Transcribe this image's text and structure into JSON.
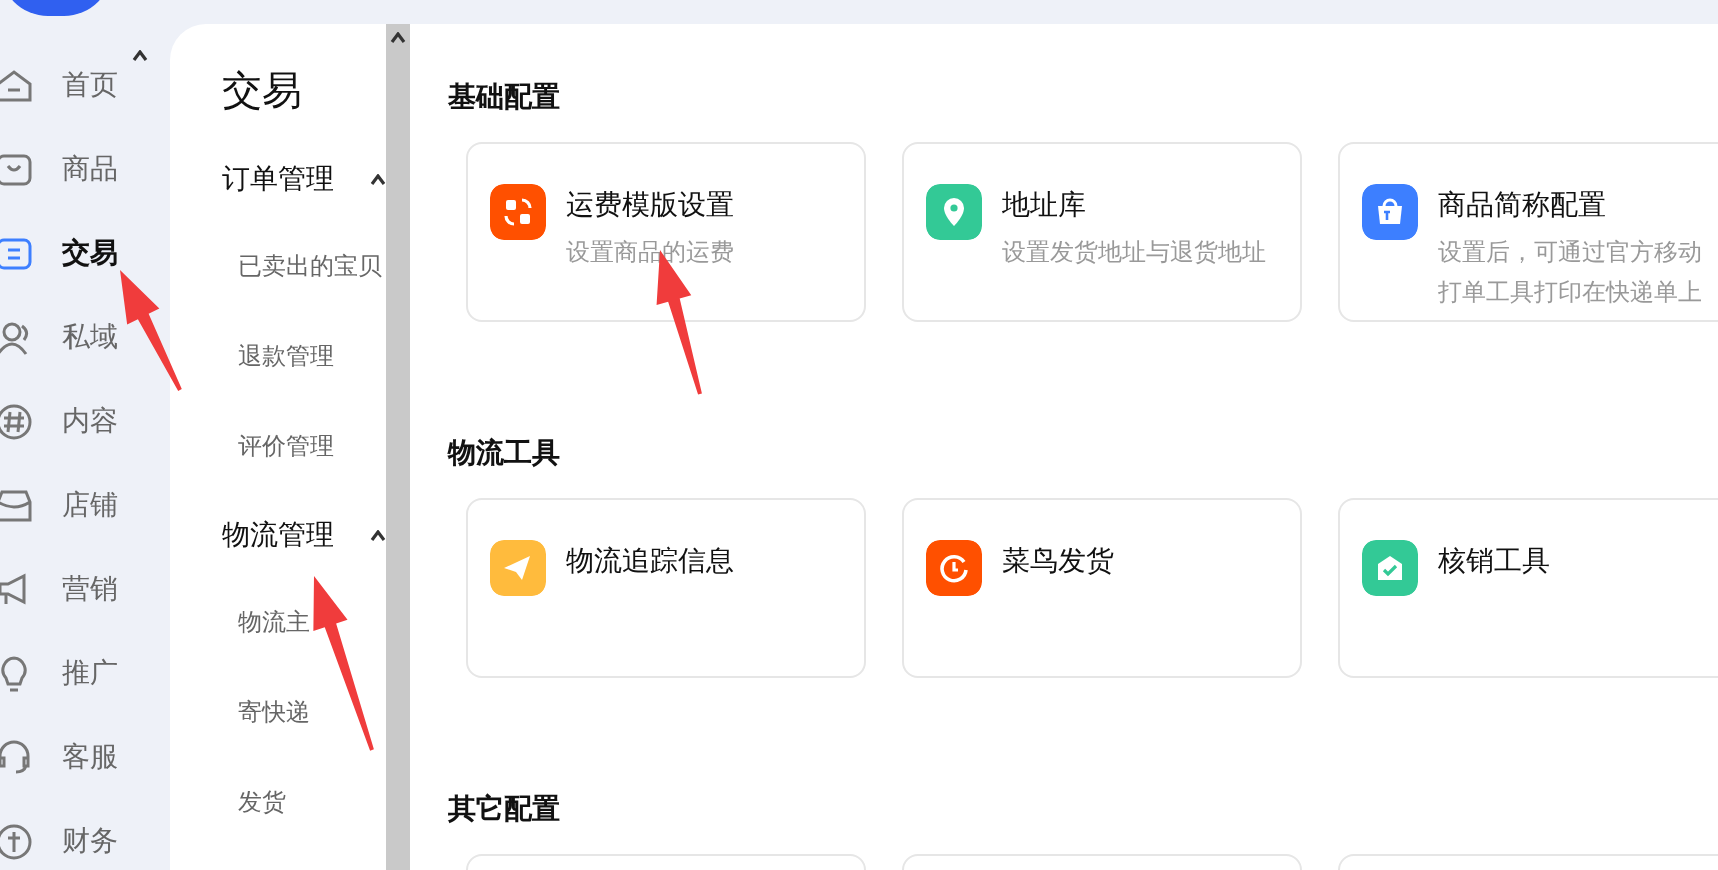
{
  "nav": {
    "items": [
      {
        "label": "首页",
        "selected": false
      },
      {
        "label": "商品",
        "selected": false
      },
      {
        "label": "交易",
        "selected": true
      },
      {
        "label": "私域",
        "selected": false
      },
      {
        "label": "内容",
        "selected": false
      },
      {
        "label": "店铺",
        "selected": false
      },
      {
        "label": "营销",
        "selected": false
      },
      {
        "label": "推广",
        "selected": false
      },
      {
        "label": "客服",
        "selected": false
      },
      {
        "label": "财务",
        "selected": false
      }
    ]
  },
  "submenu": {
    "title": "交易",
    "groups": [
      {
        "label": "订单管理",
        "expanded": true,
        "items": [
          "已卖出的宝贝",
          "退款管理",
          "评价管理"
        ]
      },
      {
        "label": "物流管理",
        "expanded": true,
        "items": [
          "物流主",
          "寄快递",
          "发货"
        ]
      }
    ]
  },
  "sections": [
    {
      "title": "基础配置",
      "cards": [
        {
          "kind": "tool",
          "title": "运费模版设置",
          "description": "设置商品的运费",
          "color": "#ff5000"
        },
        {
          "kind": "tool",
          "title": "地址库",
          "description": "设置发货地址与退货地址",
          "color": "#33c996"
        },
        {
          "kind": "tool",
          "title": "商品简称配置",
          "description": "设置后，可通过官方移动打单工具打印在快递单上",
          "color": "#3d7fff"
        }
      ]
    },
    {
      "title": "物流工具",
      "cards": [
        {
          "kind": "tool",
          "title": "物流追踪信息",
          "color": "#ffbb3d"
        },
        {
          "kind": "tool",
          "title": "菜鸟发货",
          "color": "#ff5000"
        },
        {
          "kind": "tool",
          "title": "核销工具",
          "color": "#33c996"
        }
      ]
    },
    {
      "title": "其它配置",
      "cards": [
        {
          "kind": "cut"
        },
        {
          "kind": "cut"
        },
        {
          "kind": "cut"
        }
      ]
    }
  ]
}
